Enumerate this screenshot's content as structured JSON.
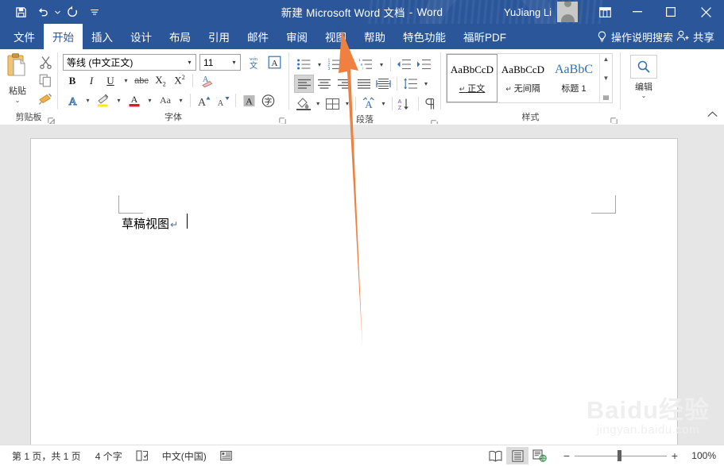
{
  "titlebar": {
    "quick_access": [
      {
        "name": "save-icon",
        "label": "保存"
      },
      {
        "name": "undo-icon",
        "label": "撤消"
      },
      {
        "name": "redo-icon",
        "label": "恢复"
      },
      {
        "name": "customize-qat-icon",
        "label": "自定义快速访问工具栏"
      }
    ],
    "document_title": "新建 Microsoft Word 文档",
    "app_name": "Word",
    "title_separator": "-",
    "user_name": "YuJiang Li",
    "avatar_name": "avatar",
    "ribbon_display_options": "功能区显示选项",
    "minimize": "—",
    "maximize": "❐",
    "close": "✕"
  },
  "tabs": [
    {
      "label": "文件",
      "active": false
    },
    {
      "label": "开始",
      "active": true
    },
    {
      "label": "插入",
      "active": false
    },
    {
      "label": "设计",
      "active": false
    },
    {
      "label": "布局",
      "active": false
    },
    {
      "label": "引用",
      "active": false
    },
    {
      "label": "邮件",
      "active": false
    },
    {
      "label": "审阅",
      "active": false
    },
    {
      "label": "视图",
      "active": false
    },
    {
      "label": "帮助",
      "active": false
    },
    {
      "label": "特色功能",
      "active": false
    },
    {
      "label": "福昕PDF",
      "active": false
    }
  ],
  "tellme": {
    "bulb_icon": "lightbulb-icon",
    "placeholder": "操作说明搜索"
  },
  "share": {
    "icon": "share-person-icon",
    "label": "共享"
  },
  "ribbon": {
    "clipboard": {
      "group_label": "剪贴板",
      "paste_label": "粘贴",
      "paste_chevron": "⌄",
      "dialog_launcher": "剪贴板对话框启动器",
      "mini": [
        {
          "name": "cut-icon",
          "label": "剪切"
        },
        {
          "name": "copy-icon",
          "label": "复制"
        },
        {
          "name": "format-painter-icon",
          "label": "格式刷"
        }
      ]
    },
    "font": {
      "group_label": "字体",
      "font_name": "等线 (中文正文)",
      "font_size": "11",
      "dialog_launcher": "字体对话框启动器",
      "row1_extra": [
        {
          "name": "phonetic-guide-icon",
          "label": "拼音指南"
        },
        {
          "name": "character-border-icon",
          "label": "字符边框"
        }
      ],
      "row2": [
        {
          "name": "bold-icon",
          "label": "B"
        },
        {
          "name": "italic-icon",
          "label": "I"
        },
        {
          "name": "underline-icon",
          "label": "U"
        },
        {
          "name": "underline-dropdown-icon",
          "label": "⌄"
        },
        {
          "name": "strikethrough-icon",
          "label": "abc"
        },
        {
          "name": "subscript-icon",
          "label": "X₂"
        },
        {
          "name": "superscript-icon",
          "label": "X²"
        },
        {
          "name": "clear-formatting-icon",
          "label": "清除所有格式"
        }
      ],
      "row3": [
        {
          "name": "text-effects-icon",
          "label": "文本效果和版式"
        },
        {
          "name": "text-highlight-icon",
          "label": "文本突出显示颜色"
        },
        {
          "name": "font-color-icon",
          "label": "字体颜色"
        },
        {
          "name": "change-case-icon",
          "label": "Aa"
        },
        {
          "name": "grow-font-icon",
          "label": "增大字号"
        },
        {
          "name": "shrink-font-icon",
          "label": "减小字号"
        },
        {
          "name": "character-shading-icon",
          "label": "字符底纹"
        },
        {
          "name": "enclose-character-icon",
          "label": "带圈字符"
        }
      ]
    },
    "paragraph": {
      "group_label": "段落",
      "dialog_launcher": "段落对话框启动器",
      "row1": [
        {
          "name": "bullets-icon",
          "label": "项目符号"
        },
        {
          "name": "bullets-dropdown-icon",
          "label": "⌄"
        },
        {
          "name": "numbering-icon",
          "label": "编号"
        },
        {
          "name": "multilevel-list-icon",
          "label": "多级列表"
        },
        {
          "name": "multilevel-dropdown-icon",
          "label": "⌄"
        },
        {
          "name": "decrease-indent-icon",
          "label": "减少缩进量"
        },
        {
          "name": "increase-indent-icon",
          "label": "增加缩进量"
        }
      ],
      "row2": [
        {
          "name": "align-left-icon",
          "label": "左对齐"
        },
        {
          "name": "align-center-icon",
          "label": "居中"
        },
        {
          "name": "align-right-icon",
          "label": "右对齐"
        },
        {
          "name": "justify-icon",
          "label": "两端对齐"
        },
        {
          "name": "distribute-icon",
          "label": "分散对齐"
        },
        {
          "name": "line-spacing-icon",
          "label": "行和段落间距"
        },
        {
          "name": "line-spacing-dropdown-icon",
          "label": "⌄"
        }
      ],
      "row3": [
        {
          "name": "shading-icon",
          "label": "底纹"
        },
        {
          "name": "shading-dropdown-icon",
          "label": "⌄"
        },
        {
          "name": "borders-icon",
          "label": "边框"
        },
        {
          "name": "borders-dropdown-icon",
          "label": "⌄"
        },
        {
          "name": "east-asian-layout-icon",
          "label": "中文版式"
        },
        {
          "name": "east-asian-dropdown-icon",
          "label": "⌄"
        },
        {
          "name": "sort-icon",
          "label": "排序"
        },
        {
          "name": "show-formatting-marks-icon",
          "label": "显示编辑标记"
        }
      ]
    },
    "styles": {
      "group_label": "样式",
      "dialog_launcher": "样式对话框启动器",
      "items": [
        {
          "preview": "AaBbCcD",
          "name": "正文",
          "mark": "↵",
          "selected": true,
          "blue": false
        },
        {
          "preview": "AaBbCcD",
          "name": "无间隔",
          "mark": "↵",
          "selected": false,
          "blue": false
        },
        {
          "preview": "AaBbC",
          "name": "标题 1",
          "mark": "",
          "selected": false,
          "blue": true
        }
      ],
      "scroll": {
        "up": "▲",
        "down": "▼",
        "more": "▤"
      }
    },
    "editing": {
      "icon": "search-magnifier-icon",
      "label": "编辑",
      "chevron": "⌄"
    },
    "collapse_ribbon": "^"
  },
  "document": {
    "text": "草稿视图",
    "paragraph_mark": "↵",
    "margin_mark_left": "margin-corner-top-left",
    "margin_mark_right": "margin-corner-top-right"
  },
  "watermark": {
    "line1_a": "Bai",
    "line1_b": "du",
    "line1_c": "经验",
    "line2": "jingyan.baidu.com"
  },
  "annotation": {
    "name": "orange-arrow-pointing-to-view-tab",
    "color": "#ef8040",
    "points_to": "视图"
  },
  "statusbar": {
    "page_info": "第 1 页，共 1 页",
    "word_count": "4 个字",
    "proofing_icon": "proofing-errors-icon",
    "language": "中文(中国)",
    "accessibility_icon": "accessibility-checker-icon",
    "views": [
      {
        "name": "read-mode-icon",
        "label": "阅读视图",
        "active": false
      },
      {
        "name": "print-layout-icon",
        "label": "页面视图",
        "active": true
      },
      {
        "name": "web-layout-icon",
        "label": "Web 版式视图",
        "active": false
      }
    ],
    "zoom_out": "−",
    "zoom_in": "+",
    "zoom_value": "100%"
  }
}
